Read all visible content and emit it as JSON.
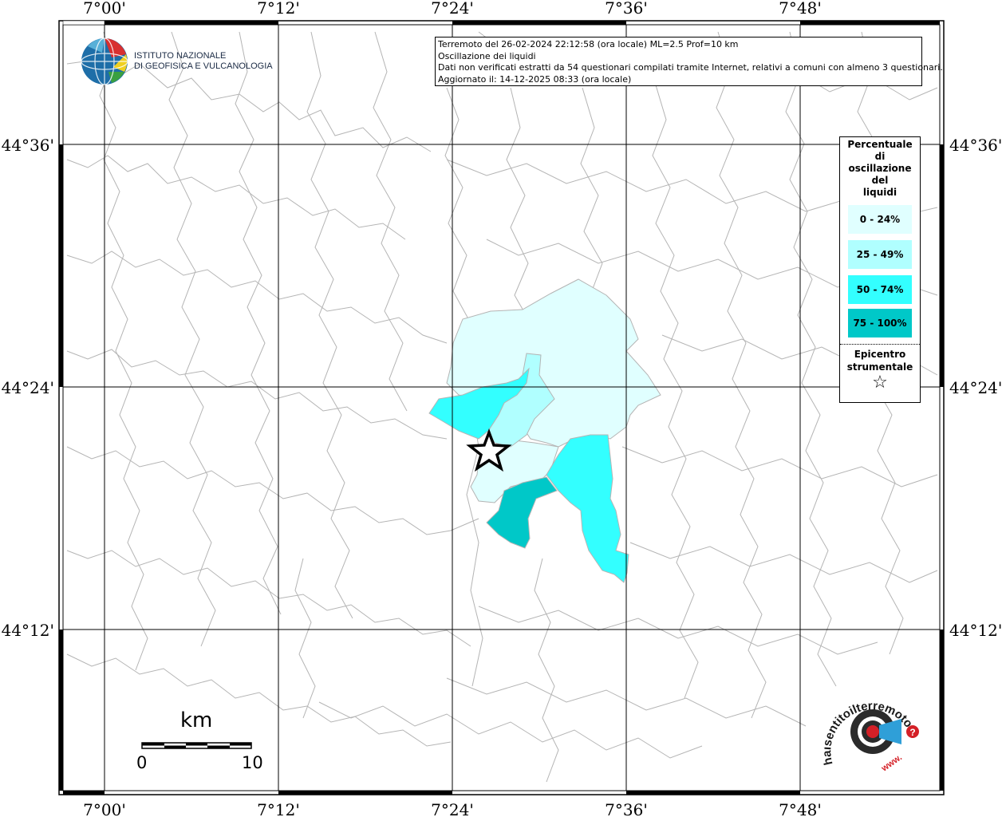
{
  "map": {
    "lon_ticks": [
      "7°00'",
      "7°12'",
      "7°24'",
      "7°36'",
      "7°48'"
    ],
    "lat_ticks": [
      "44°36'",
      "44°24'",
      "44°12'"
    ]
  },
  "info_box": {
    "line1": "Terremoto del 26-02-2024 22:12:58 (ora locale) ML=2.5 Prof=10 km",
    "line2": "Oscillazione dei liquidi",
    "line3": "Dati non verificati estratti da 54 questionari compilati tramite Internet, relativi a comuni con almeno 3 questionari.",
    "line4": "Aggiornato il: 14-12-2025 08:33 (ora locale)"
  },
  "ingv_logo": {
    "line1": "ISTITUTO NAZIONALE",
    "line2": "DI GEOFISICA E VULCANOLOGIA"
  },
  "legend": {
    "title_lines": [
      "Percentuale",
      "di",
      "oscillazione",
      "del",
      "liquidi"
    ],
    "classes": [
      {
        "label": "0 - 24%",
        "color": "#e0ffff"
      },
      {
        "label": "25 - 49%",
        "color": "#b0ffff"
      },
      {
        "label": "50 - 74%",
        "color": "#33ffff"
      },
      {
        "label": "75 - 100%",
        "color": "#00c8c8"
      }
    ],
    "epicenter_lines": [
      "Epicentro",
      "strumentale"
    ],
    "epicenter_icon": "star-outline-icon"
  },
  "scale_bar": {
    "unit": "km",
    "start_label": "0",
    "end_label": "10"
  },
  "hsit_logo": {
    "text": "haisentitoilterremoto.it",
    "web_prefix": "www.",
    "question_mark": "?"
  },
  "colors": {
    "grid_line": "#000000",
    "boundary": "#b4b4b4",
    "frame": "#000000"
  }
}
